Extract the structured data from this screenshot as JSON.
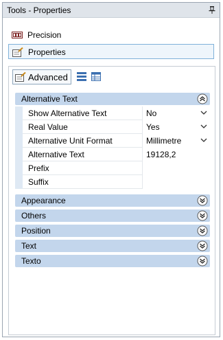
{
  "window": {
    "title": "Tools - Properties"
  },
  "nav": {
    "items": [
      {
        "label": "Precision"
      },
      {
        "label": "Properties"
      }
    ]
  },
  "toolbar": {
    "advanced_label": "Advanced"
  },
  "groups": {
    "alternative_text": {
      "label": "Alternative Text",
      "rows": [
        {
          "key": "Show Alternative Text",
          "value": "No"
        },
        {
          "key": "Real Value",
          "value": "Yes"
        },
        {
          "key": "Alternative Unit Format",
          "value": "Millimetre"
        },
        {
          "key": "Alternative Text",
          "value": "19128,2"
        },
        {
          "key": "Prefix",
          "value": ""
        },
        {
          "key": "Suffix",
          "value": ""
        }
      ]
    },
    "collapsed": [
      {
        "label": "Appearance"
      },
      {
        "label": "Others"
      },
      {
        "label": "Position"
      },
      {
        "label": "Text"
      },
      {
        "label": "Texto"
      }
    ]
  },
  "colors": {
    "group_header": "#c3d6ec",
    "selected_border": "#7fb1d9"
  },
  "icons": {
    "pin": "pin-icon",
    "precision": "precision-icon",
    "properties": "properties-icon",
    "advanced": "advanced-icon",
    "list_view": "list-view-icon",
    "table_view": "table-view-icon",
    "collapse": "chevron-double-up-icon",
    "expand": "chevron-double-down-icon",
    "dropdown": "chevron-down-icon"
  }
}
